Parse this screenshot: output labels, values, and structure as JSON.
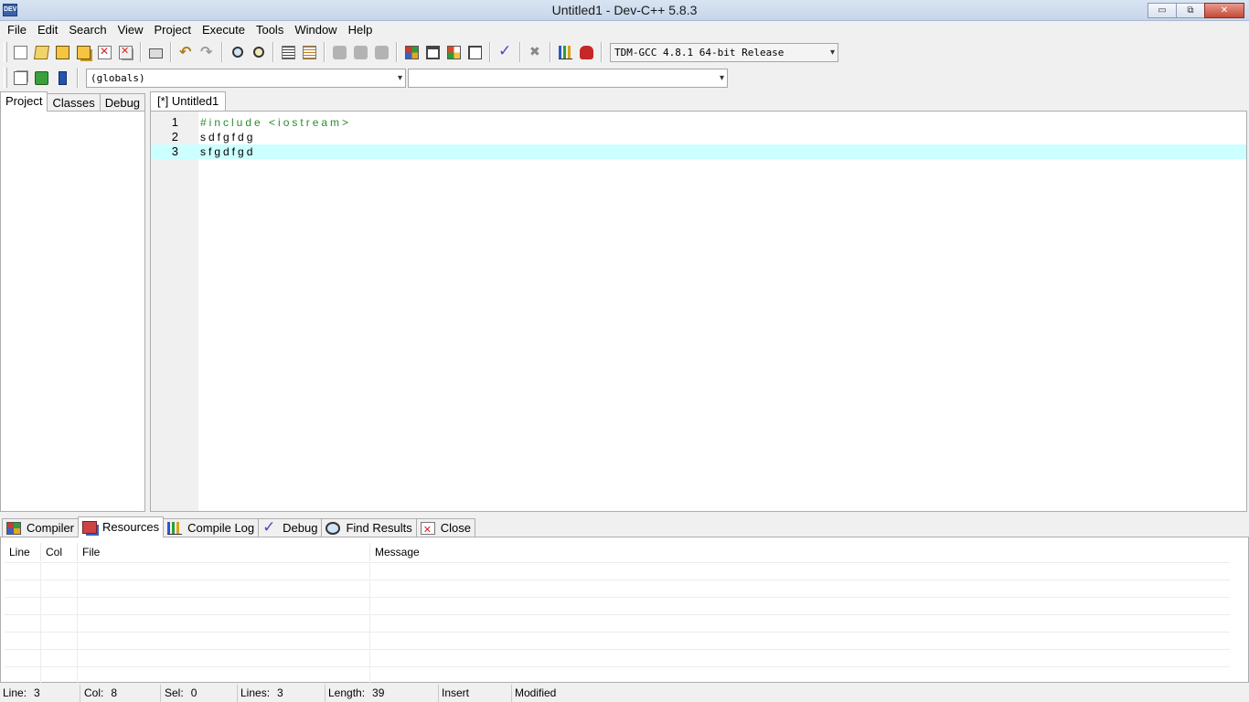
{
  "window": {
    "title": "Untitled1 - Dev-C++ 5.8.3",
    "app_icon": "DEV",
    "buttons": {
      "minimize": "▭",
      "maximize": "⧉",
      "close": "✕"
    }
  },
  "menu": [
    "File",
    "Edit",
    "Search",
    "View",
    "Project",
    "Execute",
    "Tools",
    "Window",
    "Help"
  ],
  "toolbar": {
    "compiler": "TDM-GCC 4.8.1 64-bit Release",
    "scope": "(globals)",
    "members": "",
    "dropdown_arrow": "▾"
  },
  "left_tabs": [
    "Project",
    "Classes",
    "Debug"
  ],
  "editor": {
    "tab": "[*] Untitled1",
    "lines": [
      {
        "no": "1",
        "text": "#include <iostream>"
      },
      {
        "no": "2",
        "text": "sdfgfdg"
      },
      {
        "no": "3",
        "text": "sfgdfgd"
      }
    ],
    "current_line": 3
  },
  "bottom_tabs": [
    "Compiler",
    "Resources",
    "Compile Log",
    "Debug",
    "Find Results",
    "Close"
  ],
  "messages": {
    "columns": [
      "Line",
      "Col",
      "File",
      "Message"
    ],
    "rows": []
  },
  "status": {
    "line_label": "Line:",
    "line": "3",
    "col_label": "Col:",
    "col": "8",
    "sel_label": "Sel:",
    "sel": "0",
    "lines_label": "Lines:",
    "lines": "3",
    "length_label": "Length:",
    "length": "39",
    "mode": "Insert",
    "state": "Modified"
  },
  "colors": {
    "current_line": "#ccffff",
    "directive": "#2d8a2d",
    "gutter": "#f0f0f0"
  }
}
